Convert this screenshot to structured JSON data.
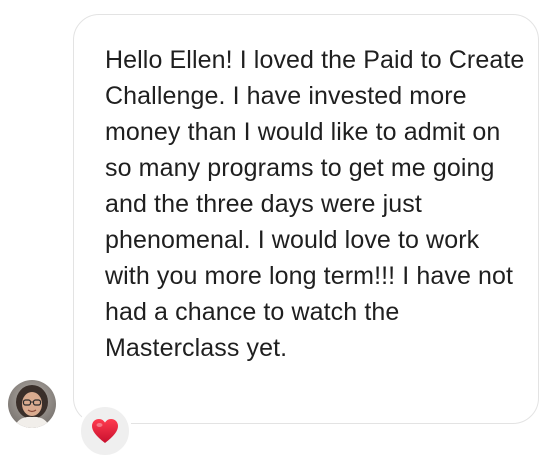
{
  "message": {
    "text": "Hello Ellen! I loved the Paid to Create Challenge. I have invested more money than I would like to admit on so many programs to get me going and the three days were just phenomenal. I would love to work with you more long term!!! I have not had a chance to watch the Masterclass yet.",
    "bubble_border_color": "#e3e3e3",
    "text_color": "#1f1f1f"
  },
  "sender": {
    "avatar_icon": "profile-photo"
  },
  "reaction": {
    "icon": "heart-icon",
    "color": "#e0182d",
    "pill_color": "#efefef"
  }
}
